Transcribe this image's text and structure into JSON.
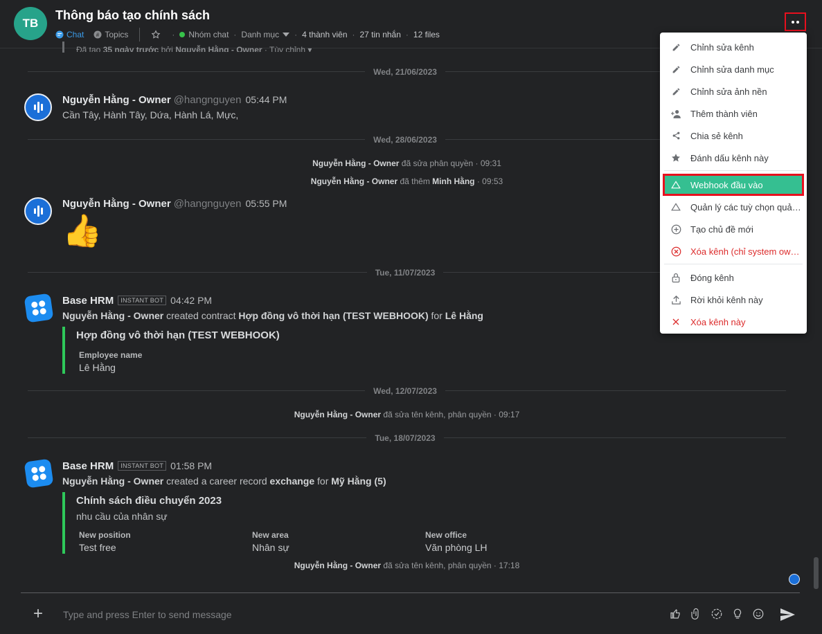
{
  "header": {
    "avatar_initials": "TB",
    "title": "Thông báo tạo chính sách",
    "tab_chat": "Chat",
    "tab_topics": "Topics",
    "group_type": "Nhóm chat",
    "category": "Danh mục",
    "members": "4 thành viên",
    "messages": "27 tin nhắn",
    "files": "12 files"
  },
  "created_info": {
    "prefix": "Đã tạo",
    "age": "35 ngày trước",
    "by_word": "bởi",
    "owner": "Nguyễn Hằng - Owner",
    "custom": "Tùy chỉnh"
  },
  "days": [
    "Wed, 21/06/2023",
    "Wed, 28/06/2023",
    "Tue, 11/07/2023",
    "Wed, 12/07/2023",
    "Tue, 18/07/2023"
  ],
  "messages": {
    "m1": {
      "name": "Nguyễn Hằng - Owner",
      "handle": "@hangnguyen",
      "time": "05:44 PM",
      "text": "Cần Tây, Hành Tây, Dứa, Hành Lá, Mực,"
    },
    "sys1": {
      "user": "Nguyễn Hằng - Owner",
      "action": "đã sửa phân quyền · 09:31"
    },
    "sys2": {
      "user": "Nguyễn Hằng - Owner",
      "action": "đã thêm",
      "target": "Minh Hằng",
      "time": "· 09:53"
    },
    "m2": {
      "name": "Nguyễn Hằng - Owner",
      "handle": "@hangnguyen",
      "time": "05:55 PM",
      "emoji": "👍"
    },
    "bot1": {
      "name": "Base HRM",
      "badge": "INSTANT BOT",
      "time": "04:42 PM",
      "actor": "Nguyễn Hằng - Owner",
      "verb": "created contract",
      "object": "Hợp đồng vô thời hạn (TEST WEBHOOK)",
      "for_word": "for",
      "person": "Lê Hằng",
      "card_title": "Hợp đồng vô thời hạn (TEST WEBHOOK)",
      "field_label": "Employee name",
      "field_value": "Lê Hằng"
    },
    "sys3": {
      "user": "Nguyễn Hằng - Owner",
      "action": "đã sửa tên kênh, phân quyền · 09:17"
    },
    "bot2": {
      "name": "Base HRM",
      "badge": "INSTANT BOT",
      "time": "01:58 PM",
      "actor": "Nguyễn Hằng - Owner",
      "verb": "created a career record",
      "object": "exchange",
      "for_word": "for",
      "person": "Mỹ Hằng (5)",
      "card_title": "Chính sách điều chuyển 2023",
      "card_sub": "nhu cầu của nhân sự",
      "f1_label": "New position",
      "f1_value": "Test free",
      "f2_label": "New area",
      "f2_value": "Nhân sự",
      "f3_label": "New office",
      "f3_value": "Văn phòng LH"
    },
    "sys4": {
      "user": "Nguyễn Hằng - Owner",
      "action": "đã sửa tên kênh, phân quyền · 17:18"
    }
  },
  "composer": {
    "placeholder": "Type and press Enter to send message"
  },
  "menu": {
    "items": [
      {
        "label": "Chỉnh sửa kênh",
        "icon": "pencil-icon"
      },
      {
        "label": "Chỉnh sửa danh mục",
        "icon": "pencil-icon"
      },
      {
        "label": "Chỉnh sửa ảnh nền",
        "icon": "pencil-icon"
      },
      {
        "label": "Thêm thành viên",
        "icon": "add-person-icon"
      },
      {
        "label": "Chia sẻ kênh",
        "icon": "share-icon"
      },
      {
        "label": "Đánh dấu kênh này",
        "icon": "star-icon"
      },
      {
        "label": "Webhook đầu vào",
        "icon": "triangle-icon"
      },
      {
        "label": "Quản lý các tuỳ chọn quả…",
        "icon": "triangle-icon"
      },
      {
        "label": "Tạo chủ đề mới",
        "icon": "plus-circle-icon"
      },
      {
        "label": "Xóa kênh (chỉ system ow…",
        "icon": "x-circle-icon"
      },
      {
        "label": "Đóng kênh",
        "icon": "lock-icon"
      },
      {
        "label": "Rời khỏi kênh này",
        "icon": "upload-icon"
      },
      {
        "label": "Xóa kênh này",
        "icon": "x-icon"
      }
    ]
  },
  "colors": {
    "accent": "#35bf91",
    "link": "#3b9be8",
    "danger": "#dc2b2b",
    "card_border": "#2ec85a"
  }
}
